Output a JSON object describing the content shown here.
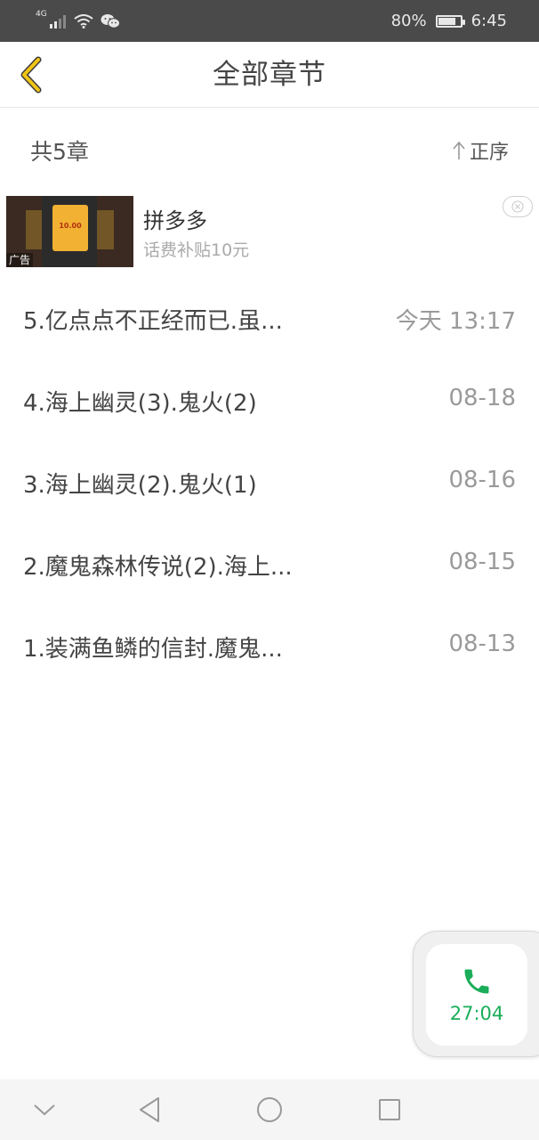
{
  "status_bar": {
    "network": "4G",
    "battery": "80%",
    "battery_level": 0.8,
    "time": "6:45"
  },
  "header": {
    "back_icon": "chevron-left-icon",
    "title": "全部章节"
  },
  "summary": {
    "count": "共5章",
    "sort_label": "正序",
    "sort_icon": "arrow-up-icon"
  },
  "ad": {
    "title": "拼多多",
    "subtitle": "话费补贴10元",
    "tag": "广告",
    "thumb_value": "10.00"
  },
  "chapters": [
    {
      "title": "5.亿点点不正经而已.虽...",
      "date": "今天 13:17"
    },
    {
      "title": "4.海上幽灵(3).鬼火(2)",
      "date": "08-18"
    },
    {
      "title": "3.海上幽灵(2).鬼火(1)",
      "date": "08-16"
    },
    {
      "title": "2.魔鬼森林传说(2).海上...",
      "date": "08-15"
    },
    {
      "title": "1.装满鱼鳞的信封.魔鬼...",
      "date": "08-13"
    }
  ],
  "call_widget": {
    "icon": "phone-icon",
    "time": "27:04"
  },
  "colors": {
    "status_bar_bg": "#4a4a4a",
    "accent_yellow": "#f0c418",
    "call_green": "#1aad5a"
  }
}
